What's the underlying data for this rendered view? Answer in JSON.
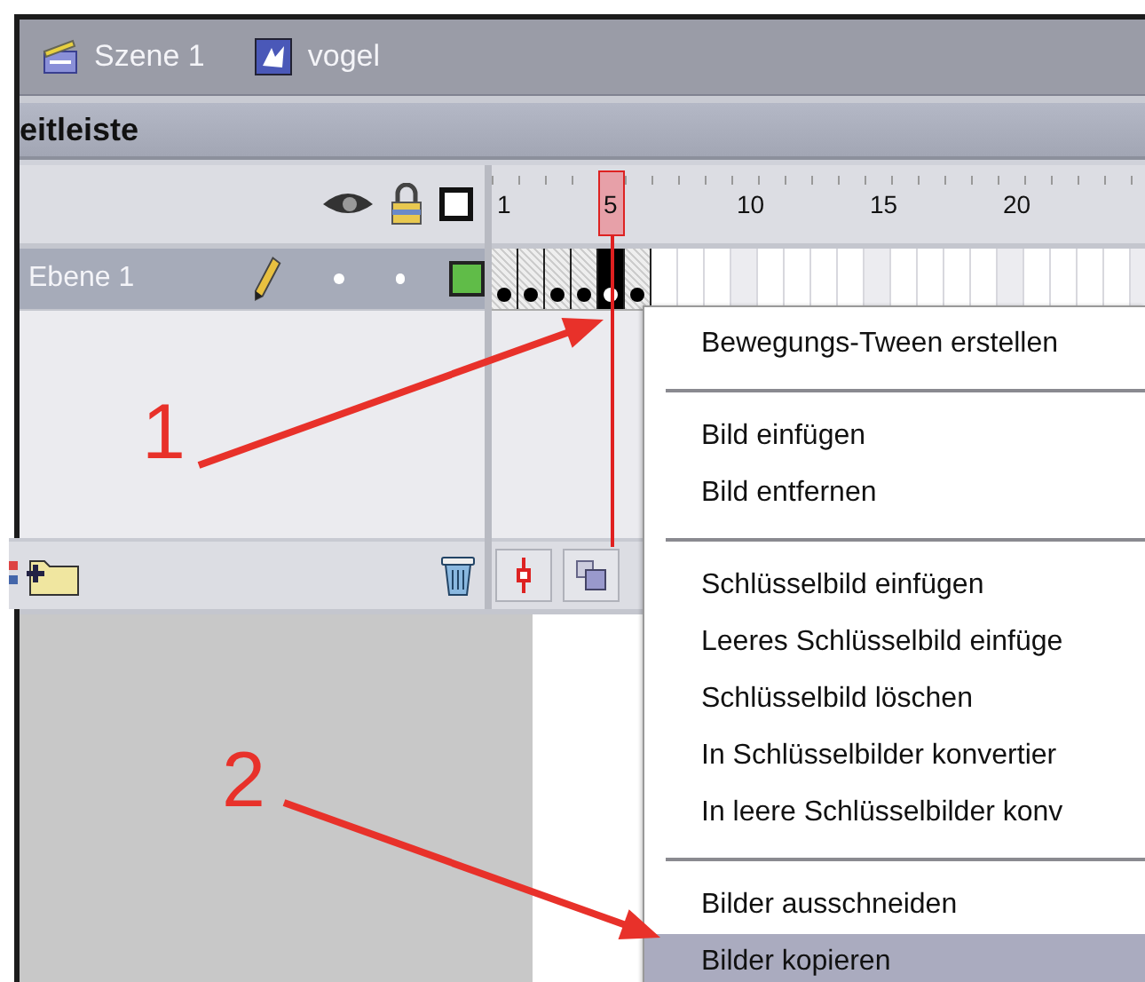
{
  "scene_bar": {
    "items": [
      {
        "label": "Szene 1",
        "kind": "scene"
      },
      {
        "label": "vogel",
        "kind": "symbol"
      }
    ]
  },
  "panel": {
    "title": "eitleiste"
  },
  "ruler": {
    "labels": [
      "1",
      "5",
      "10",
      "15",
      "20"
    ]
  },
  "layers": [
    {
      "name": "Ebene 1",
      "selected": true,
      "frames": [
        {
          "kind": "keyframe",
          "selected": false
        },
        {
          "kind": "keyframe",
          "selected": false
        },
        {
          "kind": "keyframe",
          "selected": false
        },
        {
          "kind": "keyframe",
          "selected": false
        },
        {
          "kind": "keyframe",
          "selected": true
        },
        {
          "kind": "keyframe",
          "selected": false
        }
      ]
    }
  ],
  "context_menu": {
    "groups": [
      [
        {
          "label": "Bewegungs-Tween erstellen",
          "selected": false
        }
      ],
      [
        {
          "label": "Bild einfügen",
          "selected": false
        },
        {
          "label": "Bild entfernen",
          "selected": false
        }
      ],
      [
        {
          "label": "Schlüsselbild einfügen",
          "selected": false
        },
        {
          "label": "Leeres Schlüsselbild einfüge",
          "selected": false
        },
        {
          "label": "Schlüsselbild löschen",
          "selected": false
        },
        {
          "label": "In Schlüsselbilder konvertier",
          "selected": false
        },
        {
          "label": "In leere Schlüsselbilder konv",
          "selected": false
        }
      ],
      [
        {
          "label": "Bilder ausschneiden",
          "selected": false
        },
        {
          "label": "Bilder kopieren",
          "selected": true
        }
      ]
    ]
  },
  "annotations": [
    {
      "label": "1"
    },
    {
      "label": "2"
    }
  ]
}
